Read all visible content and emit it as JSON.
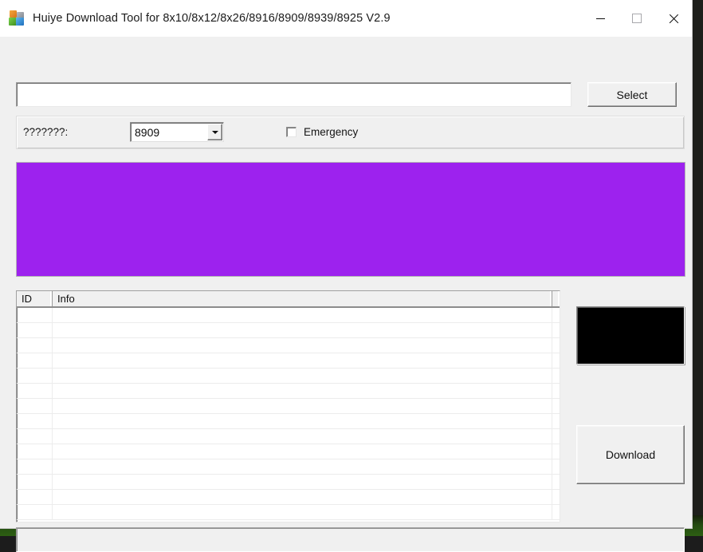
{
  "window": {
    "title": "Huiye Download Tool for 8x10/8x12/8x26/8916/8909/8939/8925 V2.9",
    "icon": "app-blocks-icon",
    "controls": {
      "minimize": "minimize-icon",
      "maximize": "maximize-icon",
      "close": "close-icon"
    }
  },
  "toolbar": {
    "path_value": "",
    "path_placeholder": "",
    "select_label": "Select"
  },
  "settings": {
    "device_label": "???????:",
    "device_value": "8909",
    "device_options": [
      "8909"
    ],
    "dropdown_icon": "chevron-down-icon",
    "emergency_label": "Emergency",
    "emergency_checked": false
  },
  "preview": {
    "color": "#9d22ee"
  },
  "list": {
    "columns": [
      "ID",
      "Info",
      ""
    ],
    "rows": [],
    "empty_row_count": 14
  },
  "output": {
    "color": "#000000",
    "text": ""
  },
  "actions": {
    "download_label": "Download"
  },
  "status": {
    "text": ""
  }
}
